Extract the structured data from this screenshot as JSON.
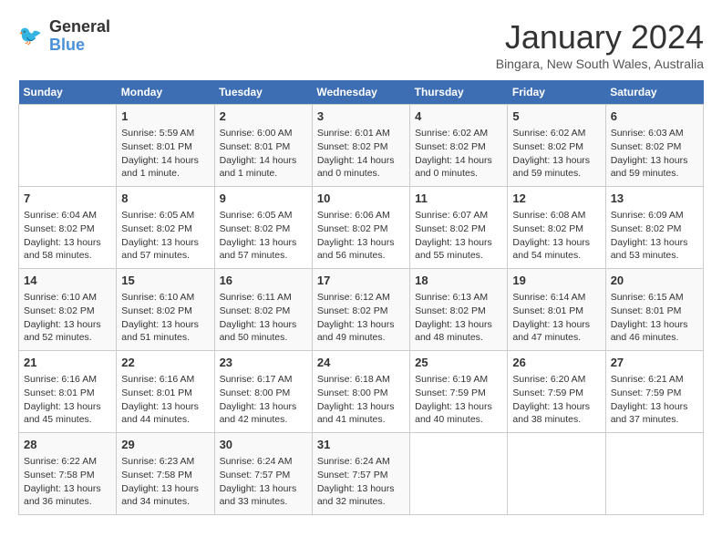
{
  "header": {
    "logo_text_line1": "General",
    "logo_text_line2": "Blue",
    "title": "January 2024",
    "location": "Bingara, New South Wales, Australia"
  },
  "days_of_week": [
    "Sunday",
    "Monday",
    "Tuesday",
    "Wednesday",
    "Thursday",
    "Friday",
    "Saturday"
  ],
  "weeks": [
    [
      {
        "day": "",
        "lines": []
      },
      {
        "day": "1",
        "lines": [
          "Sunrise: 5:59 AM",
          "Sunset: 8:01 PM",
          "Daylight: 14 hours",
          "and 1 minute."
        ]
      },
      {
        "day": "2",
        "lines": [
          "Sunrise: 6:00 AM",
          "Sunset: 8:01 PM",
          "Daylight: 14 hours",
          "and 1 minute."
        ]
      },
      {
        "day": "3",
        "lines": [
          "Sunrise: 6:01 AM",
          "Sunset: 8:02 PM",
          "Daylight: 14 hours",
          "and 0 minutes."
        ]
      },
      {
        "day": "4",
        "lines": [
          "Sunrise: 6:02 AM",
          "Sunset: 8:02 PM",
          "Daylight: 14 hours",
          "and 0 minutes."
        ]
      },
      {
        "day": "5",
        "lines": [
          "Sunrise: 6:02 AM",
          "Sunset: 8:02 PM",
          "Daylight: 13 hours",
          "and 59 minutes."
        ]
      },
      {
        "day": "6",
        "lines": [
          "Sunrise: 6:03 AM",
          "Sunset: 8:02 PM",
          "Daylight: 13 hours",
          "and 59 minutes."
        ]
      }
    ],
    [
      {
        "day": "7",
        "lines": [
          "Sunrise: 6:04 AM",
          "Sunset: 8:02 PM",
          "Daylight: 13 hours",
          "and 58 minutes."
        ]
      },
      {
        "day": "8",
        "lines": [
          "Sunrise: 6:05 AM",
          "Sunset: 8:02 PM",
          "Daylight: 13 hours",
          "and 57 minutes."
        ]
      },
      {
        "day": "9",
        "lines": [
          "Sunrise: 6:05 AM",
          "Sunset: 8:02 PM",
          "Daylight: 13 hours",
          "and 57 minutes."
        ]
      },
      {
        "day": "10",
        "lines": [
          "Sunrise: 6:06 AM",
          "Sunset: 8:02 PM",
          "Daylight: 13 hours",
          "and 56 minutes."
        ]
      },
      {
        "day": "11",
        "lines": [
          "Sunrise: 6:07 AM",
          "Sunset: 8:02 PM",
          "Daylight: 13 hours",
          "and 55 minutes."
        ]
      },
      {
        "day": "12",
        "lines": [
          "Sunrise: 6:08 AM",
          "Sunset: 8:02 PM",
          "Daylight: 13 hours",
          "and 54 minutes."
        ]
      },
      {
        "day": "13",
        "lines": [
          "Sunrise: 6:09 AM",
          "Sunset: 8:02 PM",
          "Daylight: 13 hours",
          "and 53 minutes."
        ]
      }
    ],
    [
      {
        "day": "14",
        "lines": [
          "Sunrise: 6:10 AM",
          "Sunset: 8:02 PM",
          "Daylight: 13 hours",
          "and 52 minutes."
        ]
      },
      {
        "day": "15",
        "lines": [
          "Sunrise: 6:10 AM",
          "Sunset: 8:02 PM",
          "Daylight: 13 hours",
          "and 51 minutes."
        ]
      },
      {
        "day": "16",
        "lines": [
          "Sunrise: 6:11 AM",
          "Sunset: 8:02 PM",
          "Daylight: 13 hours",
          "and 50 minutes."
        ]
      },
      {
        "day": "17",
        "lines": [
          "Sunrise: 6:12 AM",
          "Sunset: 8:02 PM",
          "Daylight: 13 hours",
          "and 49 minutes."
        ]
      },
      {
        "day": "18",
        "lines": [
          "Sunrise: 6:13 AM",
          "Sunset: 8:02 PM",
          "Daylight: 13 hours",
          "and 48 minutes."
        ]
      },
      {
        "day": "19",
        "lines": [
          "Sunrise: 6:14 AM",
          "Sunset: 8:01 PM",
          "Daylight: 13 hours",
          "and 47 minutes."
        ]
      },
      {
        "day": "20",
        "lines": [
          "Sunrise: 6:15 AM",
          "Sunset: 8:01 PM",
          "Daylight: 13 hours",
          "and 46 minutes."
        ]
      }
    ],
    [
      {
        "day": "21",
        "lines": [
          "Sunrise: 6:16 AM",
          "Sunset: 8:01 PM",
          "Daylight: 13 hours",
          "and 45 minutes."
        ]
      },
      {
        "day": "22",
        "lines": [
          "Sunrise: 6:16 AM",
          "Sunset: 8:01 PM",
          "Daylight: 13 hours",
          "and 44 minutes."
        ]
      },
      {
        "day": "23",
        "lines": [
          "Sunrise: 6:17 AM",
          "Sunset: 8:00 PM",
          "Daylight: 13 hours",
          "and 42 minutes."
        ]
      },
      {
        "day": "24",
        "lines": [
          "Sunrise: 6:18 AM",
          "Sunset: 8:00 PM",
          "Daylight: 13 hours",
          "and 41 minutes."
        ]
      },
      {
        "day": "25",
        "lines": [
          "Sunrise: 6:19 AM",
          "Sunset: 7:59 PM",
          "Daylight: 13 hours",
          "and 40 minutes."
        ]
      },
      {
        "day": "26",
        "lines": [
          "Sunrise: 6:20 AM",
          "Sunset: 7:59 PM",
          "Daylight: 13 hours",
          "and 38 minutes."
        ]
      },
      {
        "day": "27",
        "lines": [
          "Sunrise: 6:21 AM",
          "Sunset: 7:59 PM",
          "Daylight: 13 hours",
          "and 37 minutes."
        ]
      }
    ],
    [
      {
        "day": "28",
        "lines": [
          "Sunrise: 6:22 AM",
          "Sunset: 7:58 PM",
          "Daylight: 13 hours",
          "and 36 minutes."
        ]
      },
      {
        "day": "29",
        "lines": [
          "Sunrise: 6:23 AM",
          "Sunset: 7:58 PM",
          "Daylight: 13 hours",
          "and 34 minutes."
        ]
      },
      {
        "day": "30",
        "lines": [
          "Sunrise: 6:24 AM",
          "Sunset: 7:57 PM",
          "Daylight: 13 hours",
          "and 33 minutes."
        ]
      },
      {
        "day": "31",
        "lines": [
          "Sunrise: 6:24 AM",
          "Sunset: 7:57 PM",
          "Daylight: 13 hours",
          "and 32 minutes."
        ]
      },
      {
        "day": "",
        "lines": []
      },
      {
        "day": "",
        "lines": []
      },
      {
        "day": "",
        "lines": []
      }
    ]
  ]
}
